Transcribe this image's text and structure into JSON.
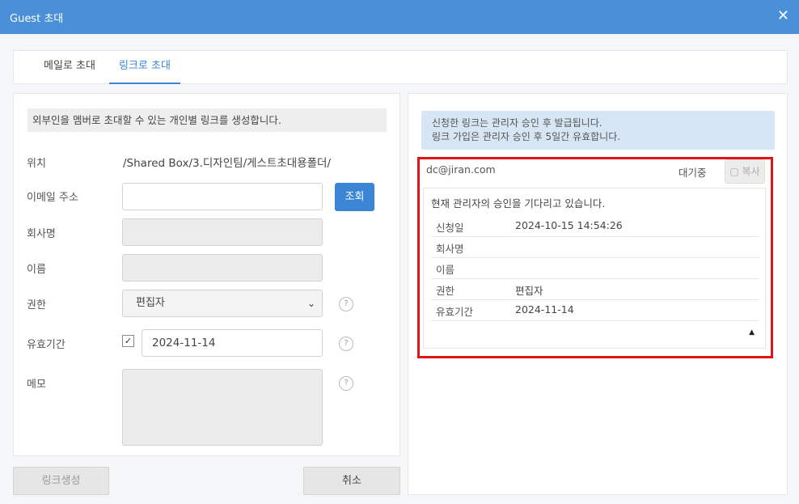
{
  "window": {
    "title": "Guest 초대",
    "close_glyph": "✕"
  },
  "tabs": [
    {
      "label": "메일로 초대",
      "active": false
    },
    {
      "label": "링크로 초대",
      "active": true
    }
  ],
  "form": {
    "info_text": "외부인을 멤버로 초대할 수 있는 개인별 링크를 생성합니다.",
    "location_label": "위치",
    "location_value": "/Shared Box/3.디자인팀/게스트초대용폴더/",
    "email_label": "이메일 주소",
    "email_value": "",
    "lookup_button": "조회",
    "company_label": "회사명",
    "company_value": "",
    "name_label": "이름",
    "name_value": "",
    "permission_label": "권한",
    "permission_value": "편집자",
    "validity_label": "유효기간",
    "validity_checked": true,
    "validity_value": "2024-11-14",
    "memo_label": "메모",
    "memo_value": "",
    "help_glyph": "?"
  },
  "buttons": {
    "create_link": "링크생성",
    "cancel": "취소"
  },
  "right": {
    "notice_line1": "신청한 링크는 관리자 승인 후 발급됩니다.",
    "notice_line2": "링크 가입은 관리자 승인 후 5일간 유효합니다.",
    "card": {
      "email": "dc@jiran.com",
      "status": "대기중",
      "copy_label": "복사",
      "message": "현재 관리자의 승인을 기다리고 있습니다.",
      "rows": [
        {
          "key": "신청일",
          "value": "2024-10-15 14:54:26"
        },
        {
          "key": "회사명",
          "value": ""
        },
        {
          "key": "이름",
          "value": ""
        },
        {
          "key": "권한",
          "value": "편집자"
        },
        {
          "key": "유효기간",
          "value": "2024-11-14"
        }
      ]
    }
  },
  "colors": {
    "titlebar": "#4a90d9",
    "accent": "#3a86d4",
    "highlight_border": "#e01414",
    "notice_bg": "#d6e6f4"
  }
}
